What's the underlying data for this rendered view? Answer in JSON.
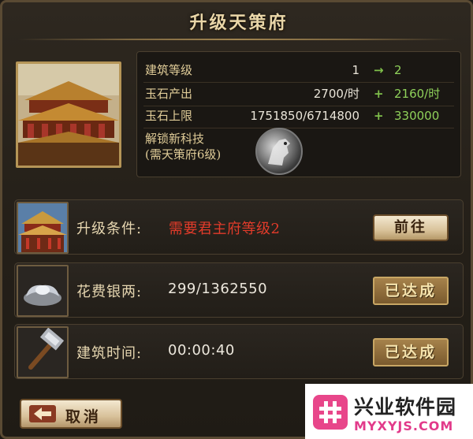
{
  "dialog": {
    "title": "升级天策府"
  },
  "stats": {
    "rows": [
      {
        "label": "建筑等级",
        "current": "1",
        "op": "→",
        "next": "2"
      },
      {
        "label": "玉石产出",
        "current": "2700/时",
        "op": "+",
        "next": "2160/时"
      },
      {
        "label": "玉石上限",
        "current": "1751850/6714800",
        "op": "+",
        "next": "330000"
      }
    ],
    "unlock_label_line1": "解锁新科技",
    "unlock_label_line2": "(需天策府6级)"
  },
  "requirements": [
    {
      "label": "升级条件:",
      "value": "需要君主府等级2",
      "action": "前往",
      "icon": "palace-icon"
    },
    {
      "label": "花费银两:",
      "value": "299/1362550",
      "status": "已达成",
      "icon": "silver-ingot-icon"
    },
    {
      "label": "建筑时间:",
      "value": "00:00:40",
      "status": "已达成",
      "icon": "hammer-icon"
    }
  ],
  "footer": {
    "cancel_label": "取消"
  },
  "watermark": {
    "title": "兴业软件园",
    "url": "MYXYJS.COM"
  },
  "colors": {
    "accent_gold": "#e0cc98",
    "increase_green": "#8fd15a",
    "requirement_red": "#e23b2a",
    "panel_bg": "#252019"
  }
}
